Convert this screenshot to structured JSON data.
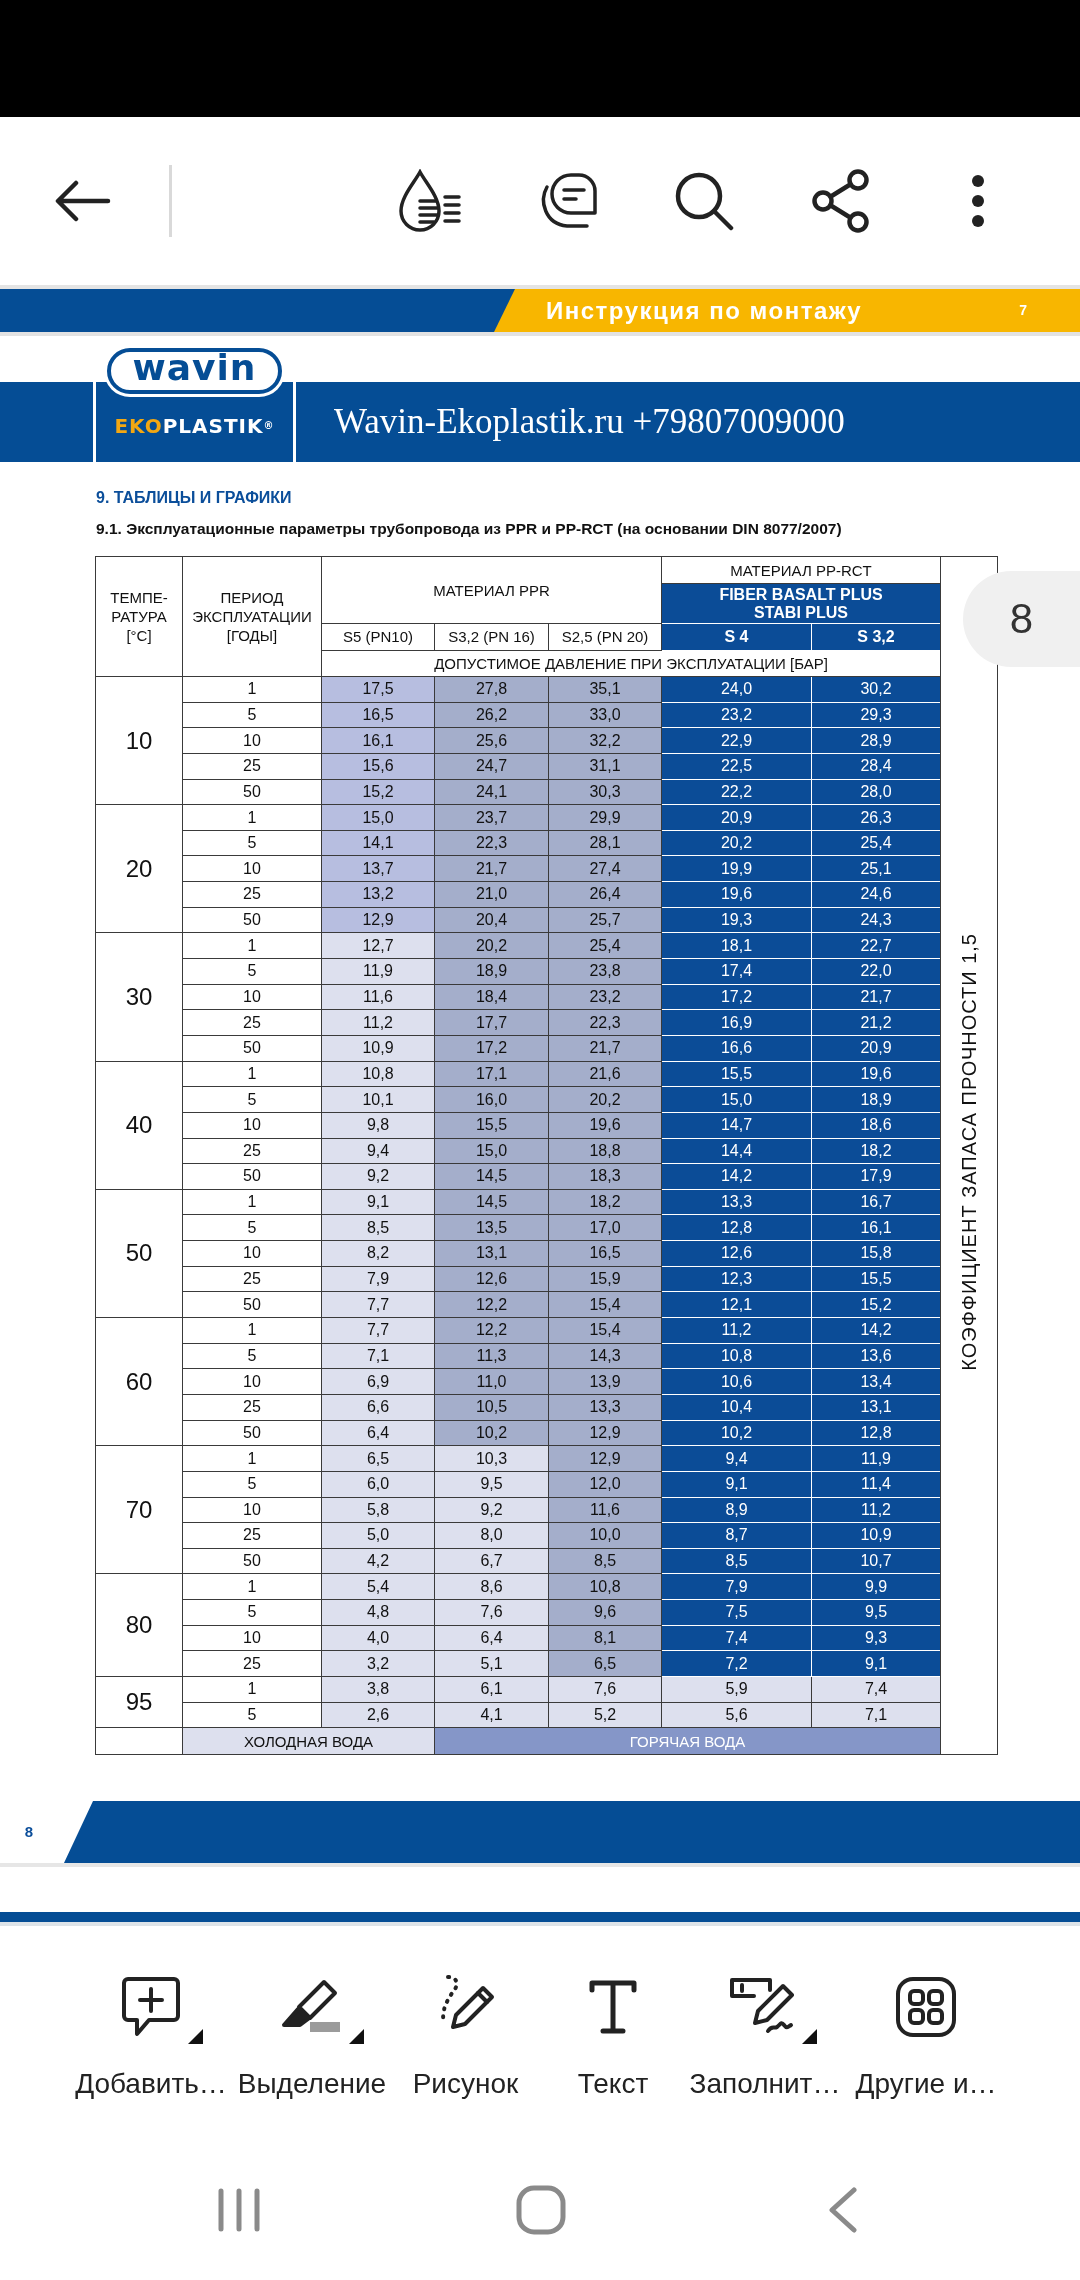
{
  "page_header": {
    "title": "Инструкция по монтажу",
    "page_number": "7"
  },
  "logo": {
    "badge": "wavin",
    "name_accent": "EKO",
    "name": "PLASTIK",
    "mark": "®"
  },
  "contact": "Wavin-Ekoplastik.ru +79807009000",
  "section_title": "9. ТАБЛИЦЫ И ГРАФИКИ",
  "table_title": "9.1. Эксплуатационные параметры трубопровода из PPR и PP-RCT (на основании DIN 8077/2007)",
  "table": {
    "header": {
      "temperature": "ТЕМПЕ-\nРАТУРА\n[°C]",
      "period": "ПЕРИОД\nЭКСПЛУАТАЦИИ\n[ГОДЫ]",
      "ppr": {
        "title": "МАТЕРИАЛ PPR",
        "series": [
          "S5 (PN10)",
          "S3,2 (PN 16)",
          "S2,5 (PN 20)"
        ]
      },
      "pp_rct": {
        "title": "МАТЕРИАЛ PP-RCT",
        "products": "FIBER BASALT PLUS\nSTABI PLUS",
        "series": [
          "S 4",
          "S 3,2"
        ]
      },
      "unit": "ДОПУСТИМОЕ ДАВЛЕНИЕ ПРИ ЭКСПЛУАТАЦИИ [БАР]"
    },
    "groups": [
      {
        "temperature": "10",
        "rows": [
          {
            "period": "1",
            "cells": [
              {
                "value": "17,5",
                "color": "#b7bee0"
              },
              {
                "value": "27,8",
                "color": "#a4aecb"
              },
              {
                "value": "35,1",
                "color": "#a4aecb"
              },
              {
                "value": "24,0",
                "color": "#0b4c97"
              },
              {
                "value": "30,2",
                "color": "#0b4c97"
              }
            ]
          },
          {
            "period": "5",
            "cells": [
              {
                "value": "16,5",
                "color": "#b7bee0"
              },
              {
                "value": "26,2",
                "color": "#a4aecb"
              },
              {
                "value": "33,0",
                "color": "#a4aecb"
              },
              {
                "value": "23,2",
                "color": "#0b4c97"
              },
              {
                "value": "29,3",
                "color": "#0b4c97"
              }
            ]
          },
          {
            "period": "10",
            "cells": [
              {
                "value": "16,1",
                "color": "#b7bee0"
              },
              {
                "value": "25,6",
                "color": "#a4aecb"
              },
              {
                "value": "32,2",
                "color": "#a4aecb"
              },
              {
                "value": "22,9",
                "color": "#0b4c97"
              },
              {
                "value": "28,9",
                "color": "#0b4c97"
              }
            ]
          },
          {
            "period": "25",
            "cells": [
              {
                "value": "15,6",
                "color": "#b7bee0"
              },
              {
                "value": "24,7",
                "color": "#a4aecb"
              },
              {
                "value": "31,1",
                "color": "#a4aecb"
              },
              {
                "value": "22,5",
                "color": "#0b4c97"
              },
              {
                "value": "28,4",
                "color": "#0b4c97"
              }
            ]
          },
          {
            "period": "50",
            "cells": [
              {
                "value": "15,2",
                "color": "#b7bee0"
              },
              {
                "value": "24,1",
                "color": "#a4aecb"
              },
              {
                "value": "30,3",
                "color": "#a4aecb"
              },
              {
                "value": "22,2",
                "color": "#0b4c97"
              },
              {
                "value": "28,0",
                "color": "#0b4c97"
              }
            ]
          }
        ]
      },
      {
        "temperature": "20",
        "rows": [
          {
            "period": "1",
            "cells": [
              {
                "value": "15,0",
                "color": "#b7bee0"
              },
              {
                "value": "23,7",
                "color": "#a4aecb"
              },
              {
                "value": "29,9",
                "color": "#a4aecb"
              },
              {
                "value": "20,9",
                "color": "#0b4c97"
              },
              {
                "value": "26,3",
                "color": "#0b4c97"
              }
            ]
          },
          {
            "period": "5",
            "cells": [
              {
                "value": "14,1",
                "color": "#b7bee0"
              },
              {
                "value": "22,3",
                "color": "#a4aecb"
              },
              {
                "value": "28,1",
                "color": "#a4aecb"
              },
              {
                "value": "20,2",
                "color": "#0b4c97"
              },
              {
                "value": "25,4",
                "color": "#0b4c97"
              }
            ]
          },
          {
            "period": "10",
            "cells": [
              {
                "value": "13,7",
                "color": "#b7bee0"
              },
              {
                "value": "21,7",
                "color": "#a4aecb"
              },
              {
                "value": "27,4",
                "color": "#a4aecb"
              },
              {
                "value": "19,9",
                "color": "#0b4c97"
              },
              {
                "value": "25,1",
                "color": "#0b4c97"
              }
            ]
          },
          {
            "period": "25",
            "cells": [
              {
                "value": "13,2",
                "color": "#b7bee0"
              },
              {
                "value": "21,0",
                "color": "#a4aecb"
              },
              {
                "value": "26,4",
                "color": "#a4aecb"
              },
              {
                "value": "19,6",
                "color": "#0b4c97"
              },
              {
                "value": "24,6",
                "color": "#0b4c97"
              }
            ]
          },
          {
            "period": "50",
            "cells": [
              {
                "value": "12,9",
                "color": "#b7bee0"
              },
              {
                "value": "20,4",
                "color": "#a4aecb"
              },
              {
                "value": "25,7",
                "color": "#a4aecb"
              },
              {
                "value": "19,3",
                "color": "#0b4c97"
              },
              {
                "value": "24,3",
                "color": "#0b4c97"
              }
            ]
          }
        ]
      },
      {
        "temperature": "30",
        "rows": [
          {
            "period": "1",
            "cells": [
              {
                "value": "12,7",
                "color": "#dde0ee"
              },
              {
                "value": "20,2",
                "color": "#a4aecb"
              },
              {
                "value": "25,4",
                "color": "#a4aecb"
              },
              {
                "value": "18,1",
                "color": "#0b4c97"
              },
              {
                "value": "22,7",
                "color": "#0b4c97"
              }
            ]
          },
          {
            "period": "5",
            "cells": [
              {
                "value": "11,9",
                "color": "#dde0ee"
              },
              {
                "value": "18,9",
                "color": "#a4aecb"
              },
              {
                "value": "23,8",
                "color": "#a4aecb"
              },
              {
                "value": "17,4",
                "color": "#0b4c97"
              },
              {
                "value": "22,0",
                "color": "#0b4c97"
              }
            ]
          },
          {
            "period": "10",
            "cells": [
              {
                "value": "11,6",
                "color": "#dde0ee"
              },
              {
                "value": "18,4",
                "color": "#a4aecb"
              },
              {
                "value": "23,2",
                "color": "#a4aecb"
              },
              {
                "value": "17,2",
                "color": "#0b4c97"
              },
              {
                "value": "21,7",
                "color": "#0b4c97"
              }
            ]
          },
          {
            "period": "25",
            "cells": [
              {
                "value": "11,2",
                "color": "#dde0ee"
              },
              {
                "value": "17,7",
                "color": "#a4aecb"
              },
              {
                "value": "22,3",
                "color": "#a4aecb"
              },
              {
                "value": "16,9",
                "color": "#0b4c97"
              },
              {
                "value": "21,2",
                "color": "#0b4c97"
              }
            ]
          },
          {
            "period": "50",
            "cells": [
              {
                "value": "10,9",
                "color": "#dde0ee"
              },
              {
                "value": "17,2",
                "color": "#a4aecb"
              },
              {
                "value": "21,7",
                "color": "#a4aecb"
              },
              {
                "value": "16,6",
                "color": "#0b4c97"
              },
              {
                "value": "20,9",
                "color": "#0b4c97"
              }
            ]
          }
        ]
      },
      {
        "temperature": "40",
        "rows": [
          {
            "period": "1",
            "cells": [
              {
                "value": "10,8",
                "color": "#dde0ee"
              },
              {
                "value": "17,1",
                "color": "#a4aecb"
              },
              {
                "value": "21,6",
                "color": "#a4aecb"
              },
              {
                "value": "15,5",
                "color": "#0b4c97"
              },
              {
                "value": "19,6",
                "color": "#0b4c97"
              }
            ]
          },
          {
            "period": "5",
            "cells": [
              {
                "value": "10,1",
                "color": "#dde0ee"
              },
              {
                "value": "16,0",
                "color": "#a4aecb"
              },
              {
                "value": "20,2",
                "color": "#a4aecb"
              },
              {
                "value": "15,0",
                "color": "#0b4c97"
              },
              {
                "value": "18,9",
                "color": "#0b4c97"
              }
            ]
          },
          {
            "period": "10",
            "cells": [
              {
                "value": "9,8",
                "color": "#dde0ee"
              },
              {
                "value": "15,5",
                "color": "#a4aecb"
              },
              {
                "value": "19,6",
                "color": "#a4aecb"
              },
              {
                "value": "14,7",
                "color": "#0b4c97"
              },
              {
                "value": "18,6",
                "color": "#0b4c97"
              }
            ]
          },
          {
            "period": "25",
            "cells": [
              {
                "value": "9,4",
                "color": "#dde0ee"
              },
              {
                "value": "15,0",
                "color": "#a4aecb"
              },
              {
                "value": "18,8",
                "color": "#a4aecb"
              },
              {
                "value": "14,4",
                "color": "#0b4c97"
              },
              {
                "value": "18,2",
                "color": "#0b4c97"
              }
            ]
          },
          {
            "period": "50",
            "cells": [
              {
                "value": "9,2",
                "color": "#dde0ee"
              },
              {
                "value": "14,5",
                "color": "#a4aecb"
              },
              {
                "value": "18,3",
                "color": "#a4aecb"
              },
              {
                "value": "14,2",
                "color": "#0b4c97"
              },
              {
                "value": "17,9",
                "color": "#0b4c97"
              }
            ]
          }
        ]
      },
      {
        "temperature": "50",
        "rows": [
          {
            "period": "1",
            "cells": [
              {
                "value": "9,1",
                "color": "#dde0ee"
              },
              {
                "value": "14,5",
                "color": "#a4aecb"
              },
              {
                "value": "18,2",
                "color": "#a4aecb"
              },
              {
                "value": "13,3",
                "color": "#0b4c97"
              },
              {
                "value": "16,7",
                "color": "#0b4c97"
              }
            ]
          },
          {
            "period": "5",
            "cells": [
              {
                "value": "8,5",
                "color": "#dde0ee"
              },
              {
                "value": "13,5",
                "color": "#a4aecb"
              },
              {
                "value": "17,0",
                "color": "#a4aecb"
              },
              {
                "value": "12,8",
                "color": "#0b4c97"
              },
              {
                "value": "16,1",
                "color": "#0b4c97"
              }
            ]
          },
          {
            "period": "10",
            "cells": [
              {
                "value": "8,2",
                "color": "#dde0ee"
              },
              {
                "value": "13,1",
                "color": "#a4aecb"
              },
              {
                "value": "16,5",
                "color": "#a4aecb"
              },
              {
                "value": "12,6",
                "color": "#0b4c97"
              },
              {
                "value": "15,8",
                "color": "#0b4c97"
              }
            ]
          },
          {
            "period": "25",
            "cells": [
              {
                "value": "7,9",
                "color": "#dde0ee"
              },
              {
                "value": "12,6",
                "color": "#a4aecb"
              },
              {
                "value": "15,9",
                "color": "#a4aecb"
              },
              {
                "value": "12,3",
                "color": "#0b4c97"
              },
              {
                "value": "15,5",
                "color": "#0b4c97"
              }
            ]
          },
          {
            "period": "50",
            "cells": [
              {
                "value": "7,7",
                "color": "#dde0ee"
              },
              {
                "value": "12,2",
                "color": "#a4aecb"
              },
              {
                "value": "15,4",
                "color": "#a4aecb"
              },
              {
                "value": "12,1",
                "color": "#0b4c97"
              },
              {
                "value": "15,2",
                "color": "#0b4c97"
              }
            ]
          }
        ]
      },
      {
        "temperature": "60",
        "rows": [
          {
            "period": "1",
            "cells": [
              {
                "value": "7,7",
                "color": "#dde0ee"
              },
              {
                "value": "12,2",
                "color": "#a4aecb"
              },
              {
                "value": "15,4",
                "color": "#a4aecb"
              },
              {
                "value": "11,2",
                "color": "#0b4c97"
              },
              {
                "value": "14,2",
                "color": "#0b4c97"
              }
            ]
          },
          {
            "period": "5",
            "cells": [
              {
                "value": "7,1",
                "color": "#dde0ee"
              },
              {
                "value": "11,3",
                "color": "#a4aecb"
              },
              {
                "value": "14,3",
                "color": "#a4aecb"
              },
              {
                "value": "10,8",
                "color": "#0b4c97"
              },
              {
                "value": "13,6",
                "color": "#0b4c97"
              }
            ]
          },
          {
            "period": "10",
            "cells": [
              {
                "value": "6,9",
                "color": "#dde0ee"
              },
              {
                "value": "11,0",
                "color": "#a4aecb"
              },
              {
                "value": "13,9",
                "color": "#a4aecb"
              },
              {
                "value": "10,6",
                "color": "#0b4c97"
              },
              {
                "value": "13,4",
                "color": "#0b4c97"
              }
            ]
          },
          {
            "period": "25",
            "cells": [
              {
                "value": "6,6",
                "color": "#dde0ee"
              },
              {
                "value": "10,5",
                "color": "#a4aecb"
              },
              {
                "value": "13,3",
                "color": "#a4aecb"
              },
              {
                "value": "10,4",
                "color": "#0b4c97"
              },
              {
                "value": "13,1",
                "color": "#0b4c97"
              }
            ]
          },
          {
            "period": "50",
            "cells": [
              {
                "value": "6,4",
                "color": "#dde0ee"
              },
              {
                "value": "10,2",
                "color": "#a4aecb"
              },
              {
                "value": "12,9",
                "color": "#a4aecb"
              },
              {
                "value": "10,2",
                "color": "#0b4c97"
              },
              {
                "value": "12,8",
                "color": "#0b4c97"
              }
            ]
          }
        ]
      },
      {
        "temperature": "70",
        "rows": [
          {
            "period": "1",
            "cells": [
              {
                "value": "6,5",
                "color": "#dde0ee"
              },
              {
                "value": "10,3",
                "color": "#dde0ee"
              },
              {
                "value": "12,9",
                "color": "#a4aecb"
              },
              {
                "value": "9,4",
                "color": "#0b4c97"
              },
              {
                "value": "11,9",
                "color": "#0b4c97"
              }
            ]
          },
          {
            "period": "5",
            "cells": [
              {
                "value": "6,0",
                "color": "#dde0ee"
              },
              {
                "value": "9,5",
                "color": "#dde0ee"
              },
              {
                "value": "12,0",
                "color": "#a4aecb"
              },
              {
                "value": "9,1",
                "color": "#0b4c97"
              },
              {
                "value": "11,4",
                "color": "#0b4c97"
              }
            ]
          },
          {
            "period": "10",
            "cells": [
              {
                "value": "5,8",
                "color": "#dde0ee"
              },
              {
                "value": "9,2",
                "color": "#dde0ee"
              },
              {
                "value": "11,6",
                "color": "#a4aecb"
              },
              {
                "value": "8,9",
                "color": "#0b4c97"
              },
              {
                "value": "11,2",
                "color": "#0b4c97"
              }
            ]
          },
          {
            "period": "25",
            "cells": [
              {
                "value": "5,0",
                "color": "#dde0ee"
              },
              {
                "value": "8,0",
                "color": "#dde0ee"
              },
              {
                "value": "10,0",
                "color": "#a4aecb"
              },
              {
                "value": "8,7",
                "color": "#0b4c97"
              },
              {
                "value": "10,9",
                "color": "#0b4c97"
              }
            ]
          },
          {
            "period": "50",
            "cells": [
              {
                "value": "4,2",
                "color": "#dde0ee"
              },
              {
                "value": "6,7",
                "color": "#dde0ee"
              },
              {
                "value": "8,5",
                "color": "#a4aecb"
              },
              {
                "value": "8,5",
                "color": "#0b4c97"
              },
              {
                "value": "10,7",
                "color": "#0b4c97"
              }
            ]
          }
        ]
      },
      {
        "temperature": "80",
        "rows": [
          {
            "period": "1",
            "cells": [
              {
                "value": "5,4",
                "color": "#dde0ee"
              },
              {
                "value": "8,6",
                "color": "#dde0ee"
              },
              {
                "value": "10,8",
                "color": "#a4aecb"
              },
              {
                "value": "7,9",
                "color": "#0b4c97"
              },
              {
                "value": "9,9",
                "color": "#0b4c97"
              }
            ]
          },
          {
            "period": "5",
            "cells": [
              {
                "value": "4,8",
                "color": "#dde0ee"
              },
              {
                "value": "7,6",
                "color": "#dde0ee"
              },
              {
                "value": "9,6",
                "color": "#a4aecb"
              },
              {
                "value": "7,5",
                "color": "#0b4c97"
              },
              {
                "value": "9,5",
                "color": "#0b4c97"
              }
            ]
          },
          {
            "period": "10",
            "cells": [
              {
                "value": "4,0",
                "color": "#dde0ee"
              },
              {
                "value": "6,4",
                "color": "#dde0ee"
              },
              {
                "value": "8,1",
                "color": "#a4aecb"
              },
              {
                "value": "7,4",
                "color": "#0b4c97"
              },
              {
                "value": "9,3",
                "color": "#0b4c97"
              }
            ]
          },
          {
            "period": "25",
            "cells": [
              {
                "value": "3,2",
                "color": "#dde0ee"
              },
              {
                "value": "5,1",
                "color": "#dde0ee"
              },
              {
                "value": "6,5",
                "color": "#a4aecb"
              },
              {
                "value": "7,2",
                "color": "#0b4c97"
              },
              {
                "value": "9,1",
                "color": "#0b4c97"
              }
            ]
          }
        ]
      },
      {
        "temperature": "95",
        "rows": [
          {
            "period": "1",
            "cells": [
              {
                "value": "3,8",
                "color": "#dde0ee"
              },
              {
                "value": "6,1",
                "color": "#dde0ee"
              },
              {
                "value": "7,6",
                "color": "#dde0ee"
              },
              {
                "value": "5,9",
                "color": "#dde0ee"
              },
              {
                "value": "7,4",
                "color": "#dde0ee"
              }
            ]
          },
          {
            "period": "5",
            "cells": [
              {
                "value": "2,6",
                "color": "#dde0ee"
              },
              {
                "value": "4,1",
                "color": "#dde0ee"
              },
              {
                "value": "5,2",
                "color": "#dde0ee"
              },
              {
                "value": "5,6",
                "color": "#dde0ee"
              },
              {
                "value": "7,1",
                "color": "#dde0ee"
              }
            ]
          }
        ]
      }
    ],
    "legend": [
      {
        "label": "ХОЛОДНАЯ ВОДА",
        "color": "#dde0ee"
      },
      {
        "label": "ГОРЯЧАЯ ВОДА",
        "color": "#8596c8"
      }
    ],
    "side_note": "КОЭФФИЦИЕНТ ЗАПАСА ПРОЧНОСТИ 1,5"
  },
  "page_indicator": "8",
  "footer": {
    "page_number": "8"
  },
  "tools": [
    {
      "label": "Добавить…",
      "menu": true
    },
    {
      "label": "Выделение",
      "menu": true
    },
    {
      "label": "Рисунок",
      "menu": false
    },
    {
      "label": "Текст",
      "menu": false
    },
    {
      "label": "Заполнит…",
      "menu": true
    },
    {
      "label": "Другие и…",
      "menu": false
    }
  ]
}
